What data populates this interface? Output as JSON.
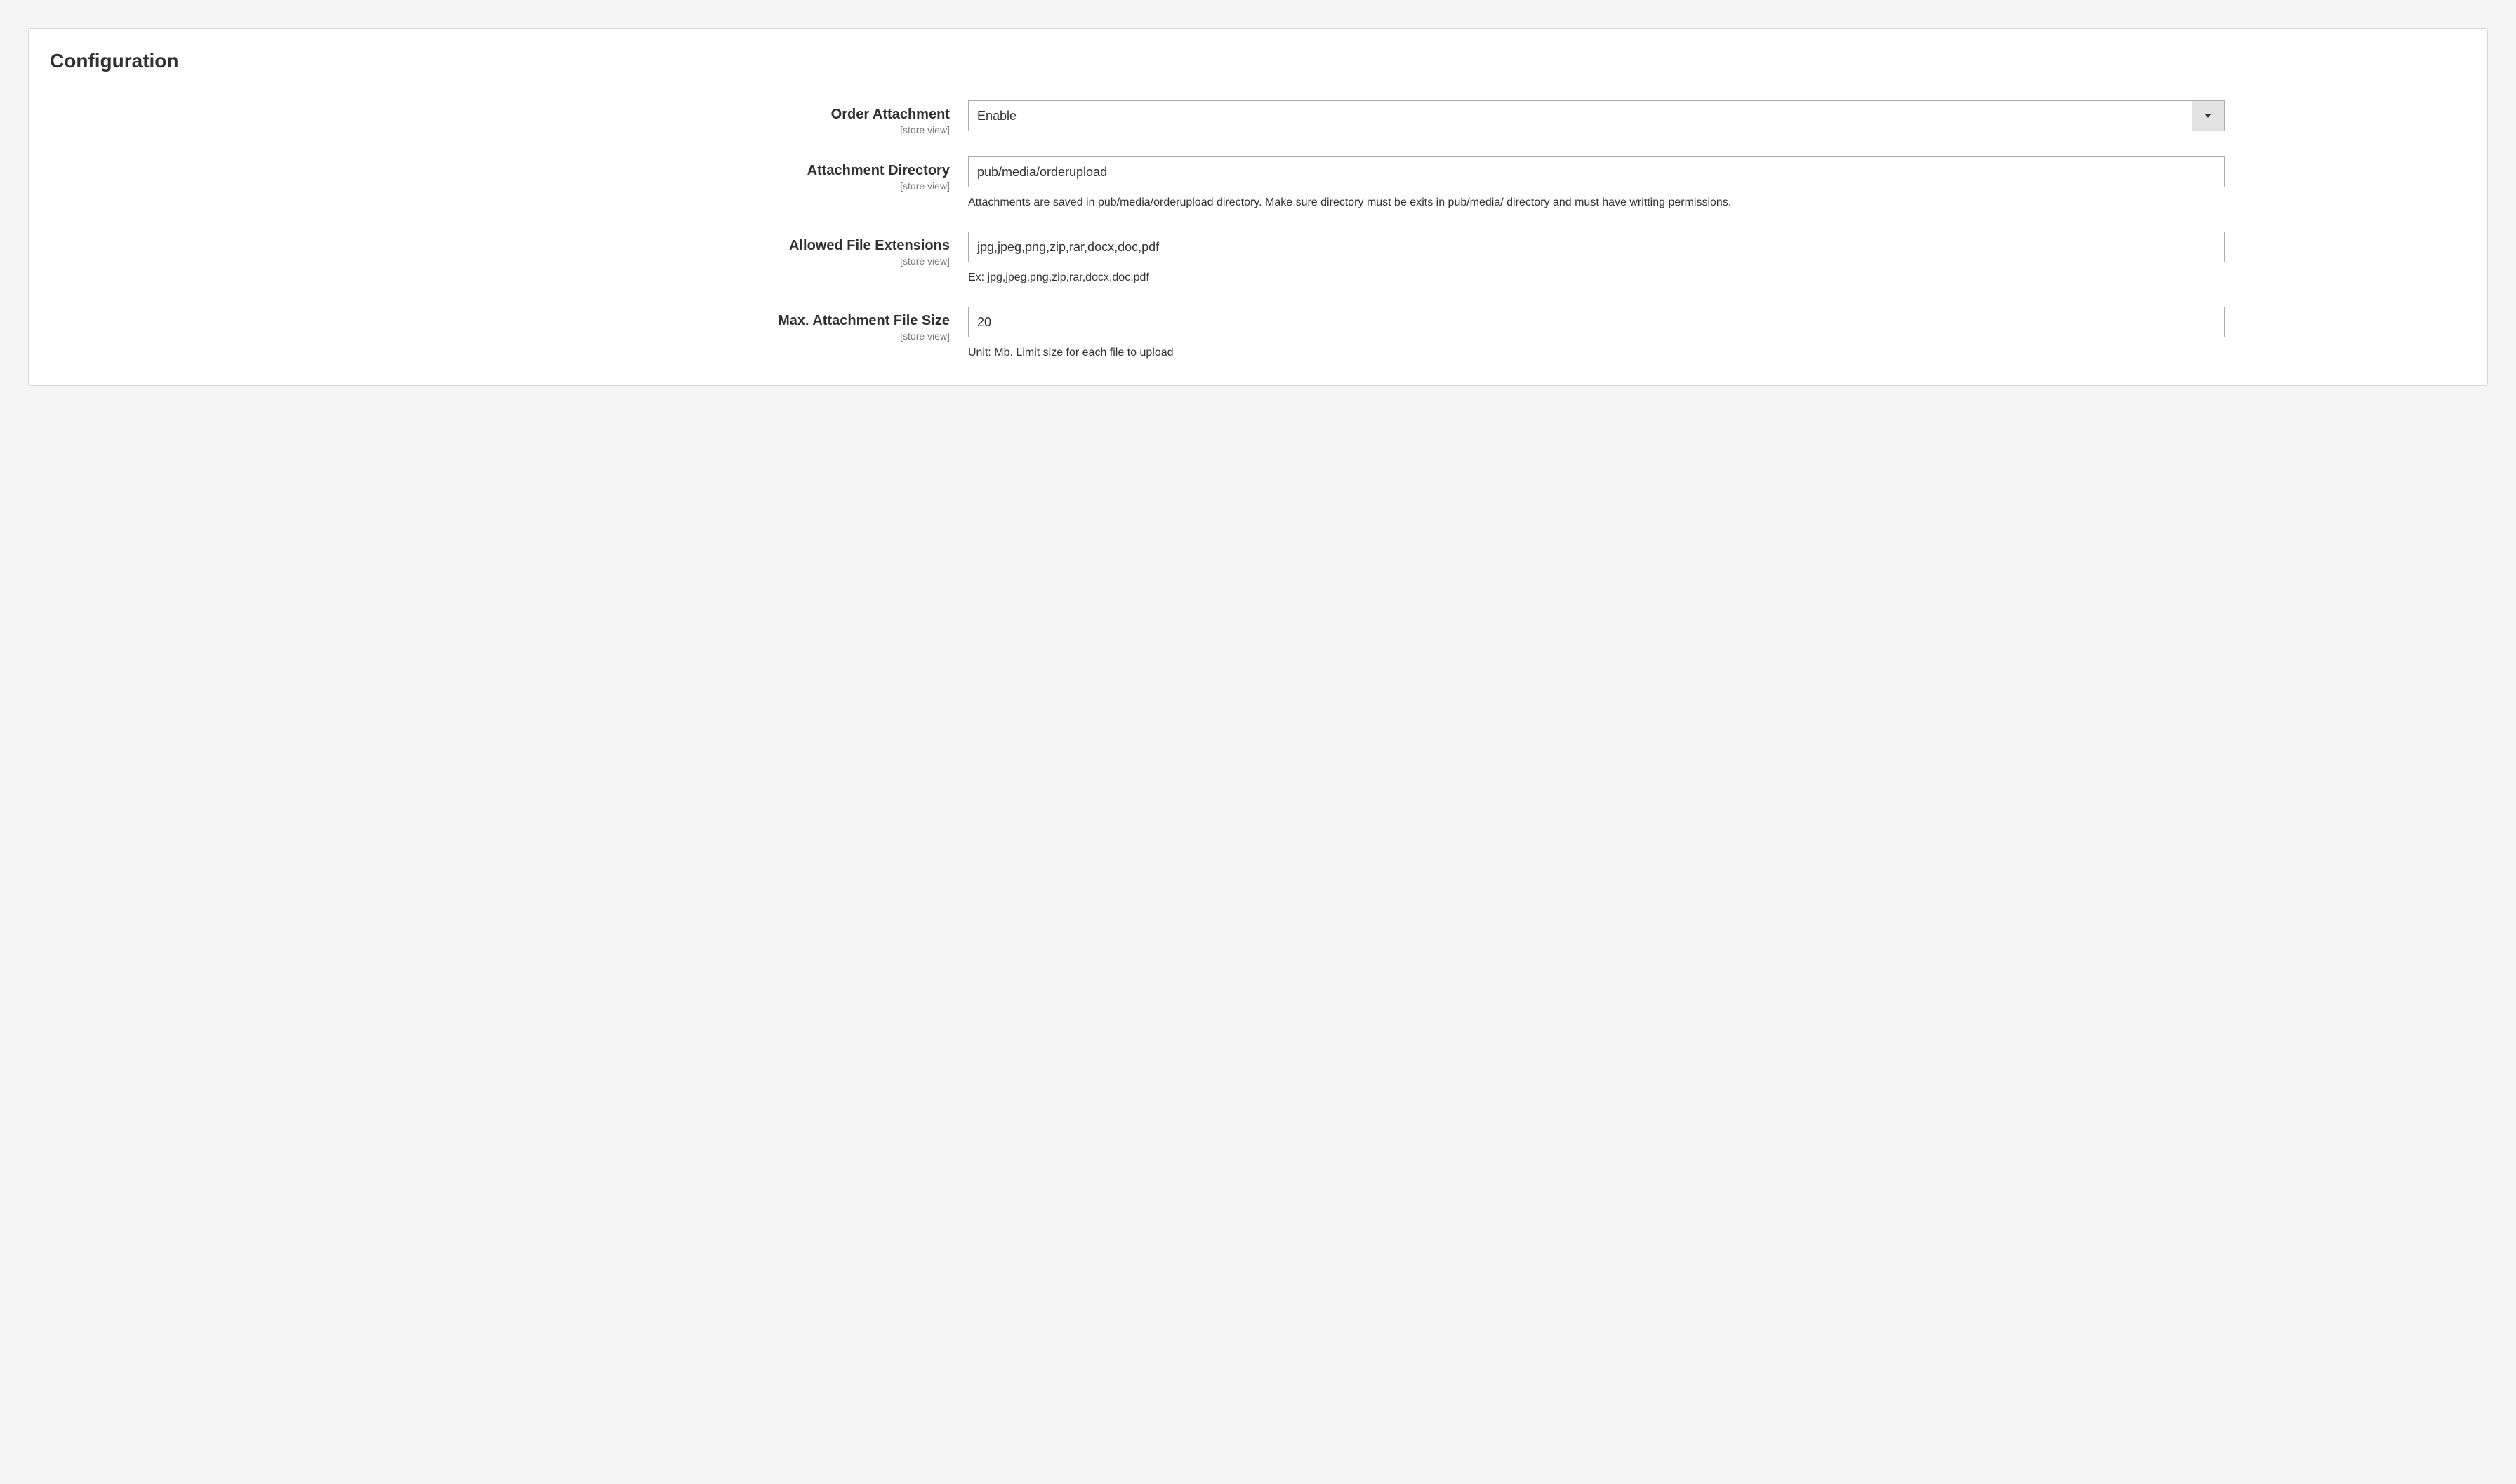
{
  "panel": {
    "title": "Configuration"
  },
  "scope_text": "[store view]",
  "fields": {
    "order_attachment": {
      "label": "Order Attachment",
      "value": "Enable"
    },
    "attachment_directory": {
      "label": "Attachment Directory",
      "value": "pub/media/orderupload",
      "note": "Attachments are saved in pub/media/orderupload directory. Make sure directory must be exits in pub/media/ directory and must have writting permissions."
    },
    "allowed_file_extensions": {
      "label": "Allowed File Extensions",
      "value": "jpg,jpeg,png,zip,rar,docx,doc,pdf",
      "note": "Ex: jpg,jpeg,png,zip,rar,docx,doc,pdf"
    },
    "max_file_size": {
      "label": "Max. Attachment File Size",
      "value": "20",
      "note": "Unit: Mb. Limit size for each file to upload"
    }
  }
}
